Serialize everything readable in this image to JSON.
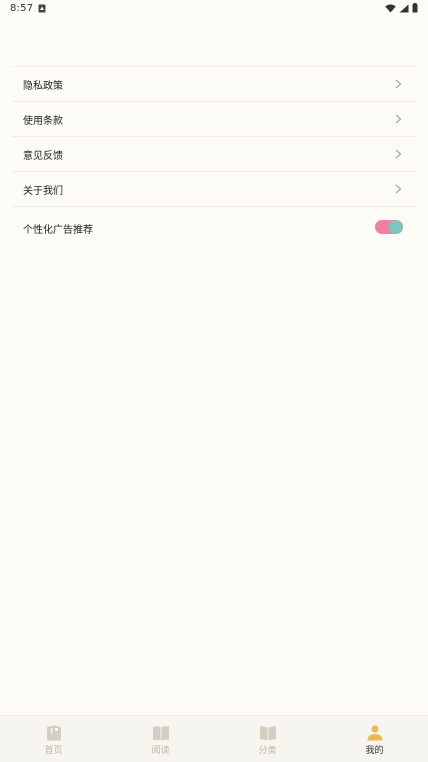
{
  "status_bar": {
    "time": "8:57"
  },
  "menu": {
    "items": [
      {
        "label": "隐私政策"
      },
      {
        "label": "使用条款"
      },
      {
        "label": "意见反馈"
      },
      {
        "label": "关于我们"
      }
    ],
    "toggle": {
      "label": "个性化广告推荐",
      "on": true
    }
  },
  "tabbar": {
    "tabs": [
      {
        "label": "首页",
        "icon": "home-icon",
        "active": false
      },
      {
        "label": "阅读",
        "icon": "book-icon",
        "active": false
      },
      {
        "label": "分类",
        "icon": "category-icon",
        "active": false
      },
      {
        "label": "我的",
        "icon": "profile-icon",
        "active": true
      }
    ]
  },
  "colors": {
    "background": "#fdfbf6",
    "toggle_track": "#f07fa0",
    "toggle_knob": "#7ac7c0",
    "tab_inactive": "#d3cdc2",
    "tab_active": "#e8b955"
  }
}
